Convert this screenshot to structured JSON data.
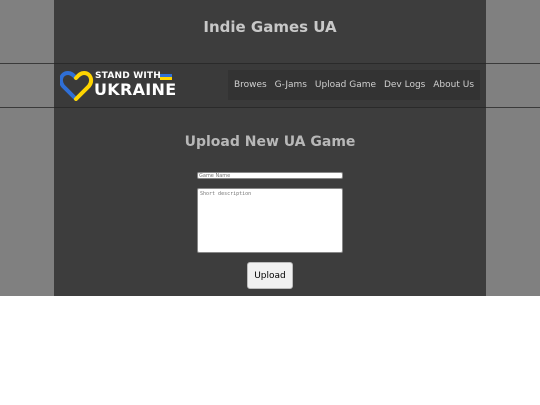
{
  "header": {
    "site_title": "Indie Games UA"
  },
  "logo": {
    "line1": "STAND WITH",
    "line2": "UKRAINE",
    "flag_blue": "#2f6fd6",
    "flag_yellow": "#ffd500"
  },
  "nav": {
    "items": [
      {
        "label": "Browes"
      },
      {
        "label": "G-Jams"
      },
      {
        "label": "Upload Game"
      },
      {
        "label": "Dev Logs"
      },
      {
        "label": "About Us"
      }
    ]
  },
  "form": {
    "title": "Upload New UA Game",
    "name_placeholder": "Game Name",
    "description_placeholder": "Short description",
    "submit_label": "Upload"
  }
}
